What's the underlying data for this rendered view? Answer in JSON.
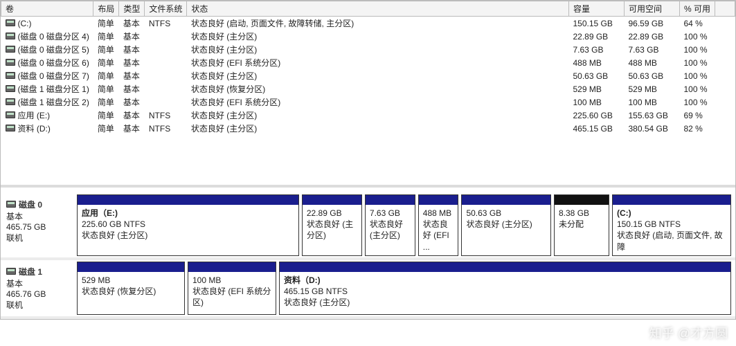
{
  "columns": {
    "volume": "卷",
    "layout": "布局",
    "type": "类型",
    "fs": "文件系统",
    "status": "状态",
    "capacity": "容量",
    "free": "可用空间",
    "pctfree": "% 可用"
  },
  "volumes": [
    {
      "name": "(C:)",
      "layout": "简单",
      "type": "基本",
      "fs": "NTFS",
      "status": "状态良好 (启动, 页面文件, 故障转储, 主分区)",
      "cap": "150.15 GB",
      "free": "96.59 GB",
      "pct": "64 %"
    },
    {
      "name": "(磁盘 0 磁盘分区 4)",
      "layout": "简单",
      "type": "基本",
      "fs": "",
      "status": "状态良好 (主分区)",
      "cap": "22.89 GB",
      "free": "22.89 GB",
      "pct": "100 %"
    },
    {
      "name": "(磁盘 0 磁盘分区 5)",
      "layout": "简单",
      "type": "基本",
      "fs": "",
      "status": "状态良好 (主分区)",
      "cap": "7.63 GB",
      "free": "7.63 GB",
      "pct": "100 %"
    },
    {
      "name": "(磁盘 0 磁盘分区 6)",
      "layout": "简单",
      "type": "基本",
      "fs": "",
      "status": "状态良好 (EFI 系统分区)",
      "cap": "488 MB",
      "free": "488 MB",
      "pct": "100 %"
    },
    {
      "name": "(磁盘 0 磁盘分区 7)",
      "layout": "简单",
      "type": "基本",
      "fs": "",
      "status": "状态良好 (主分区)",
      "cap": "50.63 GB",
      "free": "50.63 GB",
      "pct": "100 %"
    },
    {
      "name": "(磁盘 1 磁盘分区 1)",
      "layout": "简单",
      "type": "基本",
      "fs": "",
      "status": "状态良好 (恢复分区)",
      "cap": "529 MB",
      "free": "529 MB",
      "pct": "100 %"
    },
    {
      "name": "(磁盘 1 磁盘分区 2)",
      "layout": "简单",
      "type": "基本",
      "fs": "",
      "status": "状态良好 (EFI 系统分区)",
      "cap": "100 MB",
      "free": "100 MB",
      "pct": "100 %"
    },
    {
      "name": "应用 (E:)",
      "layout": "简单",
      "type": "基本",
      "fs": "NTFS",
      "status": "状态良好 (主分区)",
      "cap": "225.60 GB",
      "free": "155.63 GB",
      "pct": "69 %"
    },
    {
      "name": "资料 (D:)",
      "layout": "简单",
      "type": "基本",
      "fs": "NTFS",
      "status": "状态良好 (主分区)",
      "cap": "465.15 GB",
      "free": "380.54 GB",
      "pct": "82 %"
    }
  ],
  "disks": [
    {
      "title": "磁盘 0",
      "type": "基本",
      "size": "465.75 GB",
      "state": "联机",
      "parts": [
        {
          "flex": 225,
          "title": "应用（E:)",
          "l2": "225.60 GB NTFS",
          "l3": "状态良好 (主分区)",
          "bar": "normal"
        },
        {
          "flex": 60,
          "title": "",
          "l2": "22.89 GB",
          "l3": "状态良好 (主分区)",
          "bar": "normal"
        },
        {
          "flex": 50,
          "title": "",
          "l2": "7.63 GB",
          "l3": "状态良好 (主分区)",
          "bar": "normal"
        },
        {
          "flex": 40,
          "title": "",
          "l2": "488 MB",
          "l3": "状态良好 (EFI ...",
          "bar": "normal"
        },
        {
          "flex": 90,
          "title": "",
          "l2": "50.63 GB",
          "l3": "状态良好 (主分区)",
          "bar": "normal"
        },
        {
          "flex": 55,
          "title": "",
          "l2": "8.38 GB",
          "l3": "未分配",
          "bar": "unalloc"
        },
        {
          "flex": 120,
          "title": "(C:)",
          "l2": "150.15 GB NTFS",
          "l3": "状态良好 (启动, 页面文件, 故障",
          "bar": "normal"
        }
      ]
    },
    {
      "title": "磁盘 1",
      "type": "基本",
      "size": "465.76 GB",
      "state": "联机",
      "parts": [
        {
          "flex": 110,
          "title": "",
          "l2": "529 MB",
          "l3": "状态良好 (恢复分区)",
          "bar": "normal"
        },
        {
          "flex": 90,
          "title": "",
          "l2": "100 MB",
          "l3": "状态良好 (EFI 系统分区)",
          "bar": "normal"
        },
        {
          "flex": 465,
          "title": "资料（D:)",
          "l2": "465.15 GB NTFS",
          "l3": "状态良好 (主分区)",
          "bar": "normal"
        }
      ]
    }
  ],
  "watermark": "知乎 @才方圆"
}
